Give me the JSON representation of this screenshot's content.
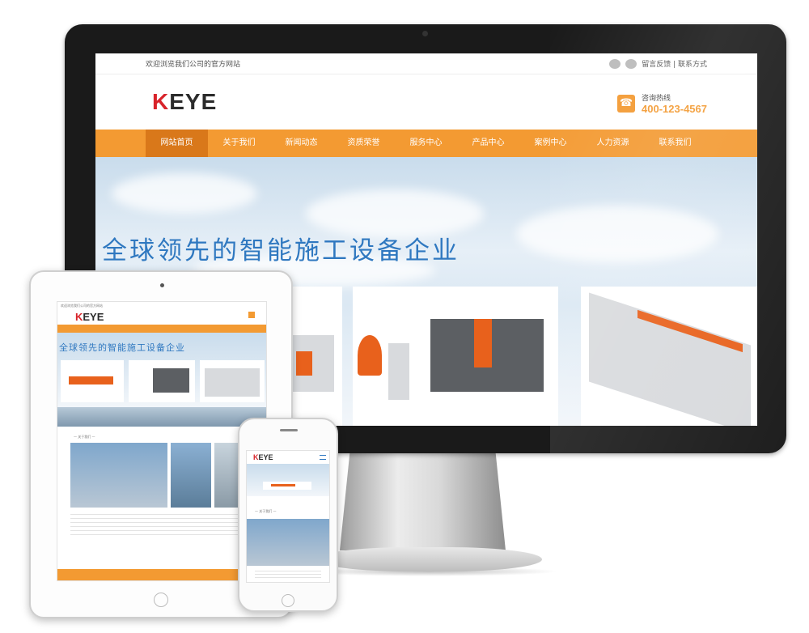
{
  "site": {
    "welcome_text": "欢迎浏览我们公司的官方网站",
    "links": "留言反馈 | 联系方式",
    "logo_k": "K",
    "logo_rest": "EYE",
    "hotline_label": "咨询热线",
    "hotline_number": "400-123-4567",
    "nav": [
      "网站首页",
      "关于我们",
      "新闻动态",
      "资质荣誉",
      "服务中心",
      "产品中心",
      "案例中心",
      "人力资源",
      "联系我们"
    ],
    "active_nav": 0,
    "slogan": "全球领先的智能施工设备企业",
    "about_heading": "— 关于我们 —"
  },
  "icons": {
    "weibo": "weibo-icon",
    "wechat": "wechat-icon",
    "phone": "phone-icon",
    "menu": "menu-icon"
  },
  "colors": {
    "accent": "#f39a32",
    "accent_dark": "#d9781a",
    "logo_red": "#d8232a",
    "slogan_blue": "#2f78c0",
    "bezel": "#1a1a1a"
  }
}
